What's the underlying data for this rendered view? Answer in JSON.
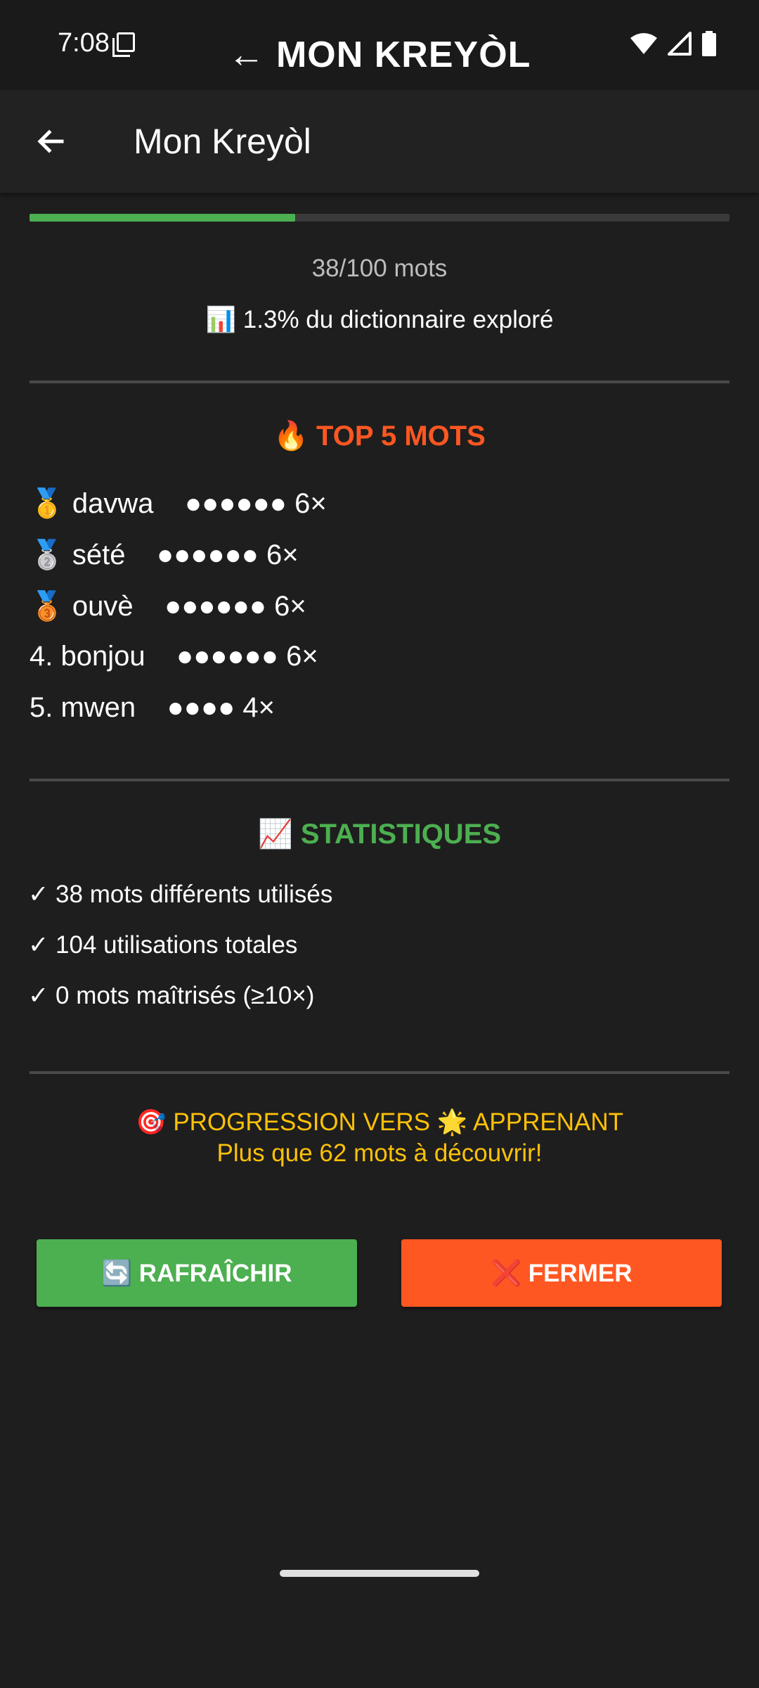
{
  "status_bar": {
    "time": "7:08",
    "title": "← MON KREYÒL",
    "icons": [
      "sim-icon",
      "wifi-icon",
      "signal-icon",
      "battery-icon"
    ]
  },
  "app_bar": {
    "title": "Mon Kreyòl"
  },
  "progress": {
    "value_fraction": 0.38,
    "count_text": "38/100 mots",
    "explored_text": "📊 1.3% du dictionnaire exploré"
  },
  "top_words": {
    "title": "🔥 TOP 5 MOTS",
    "items": [
      "🥇 davwa    ●●●●●● 6×",
      "🥈 sété    ●●●●●● 6×",
      "🥉 ouvè    ●●●●●● 6×",
      "4. bonjou    ●●●●●● 6×",
      "5. mwen    ●●●● 4×"
    ]
  },
  "statistics": {
    "title": "📈 STATISTIQUES",
    "items": [
      "✓ 38 mots différents utilisés",
      "✓ 104 utilisations totales",
      "✓ 0 mots maîtrisés (≥10×)"
    ]
  },
  "level_progress": {
    "line1": "🎯 PROGRESSION VERS 🌟 APPRENANT",
    "line2": "Plus que 62 mots à découvrir!"
  },
  "buttons": {
    "refresh": "🔄 RAFRAÎCHIR",
    "close": "❌ FERMER"
  },
  "colors": {
    "accent_green": "#4caf50",
    "accent_orange": "#ff5722",
    "accent_yellow": "#ffc107",
    "background": "#1e1e1e"
  }
}
